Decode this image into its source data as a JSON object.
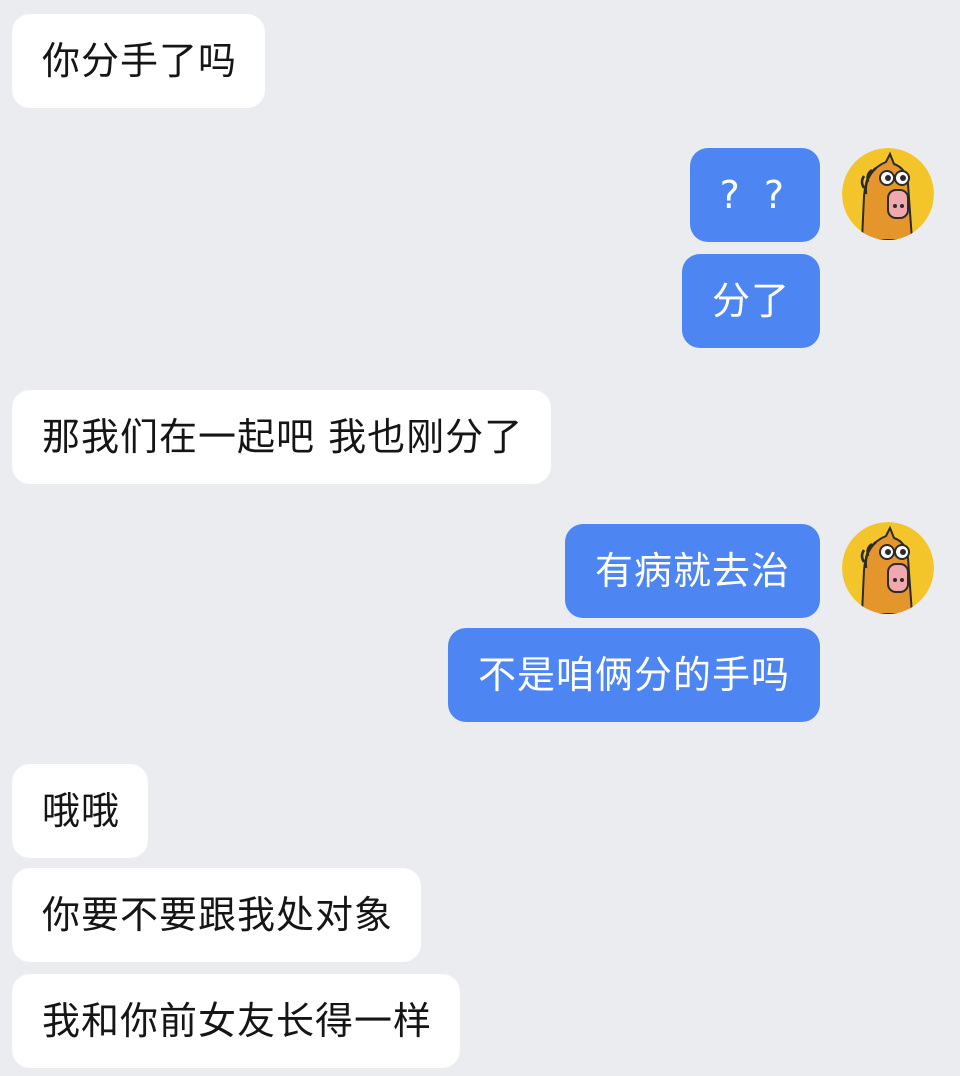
{
  "conversation": {
    "messages": [
      {
        "sender": "contact",
        "text": "你分手了吗"
      },
      {
        "sender": "me",
        "text": "? ?"
      },
      {
        "sender": "me",
        "text": "分了"
      },
      {
        "sender": "contact",
        "text": "那我们在一起吧 我也刚分了"
      },
      {
        "sender": "me",
        "text": "有病就去治"
      },
      {
        "sender": "me",
        "text": "不是咱俩分的手吗"
      },
      {
        "sender": "contact",
        "text": "哦哦"
      },
      {
        "sender": "contact",
        "text": "你要不要跟我处对象"
      },
      {
        "sender": "contact",
        "text": "我和你前女友长得一样"
      }
    ],
    "my_avatar": {
      "icon": "horse-avatar-icon",
      "colors": {
        "background": "#f4c52a",
        "face": "#e4962c",
        "muzzle": "#f0a7ad",
        "outline": "#2b2b2b"
      }
    },
    "colors": {
      "background": "#ebecf0",
      "incoming_bubble": "#ffffff",
      "outgoing_bubble": "#4d85f2",
      "outgoing_text": "#ffffff",
      "incoming_text": "#151515"
    }
  }
}
